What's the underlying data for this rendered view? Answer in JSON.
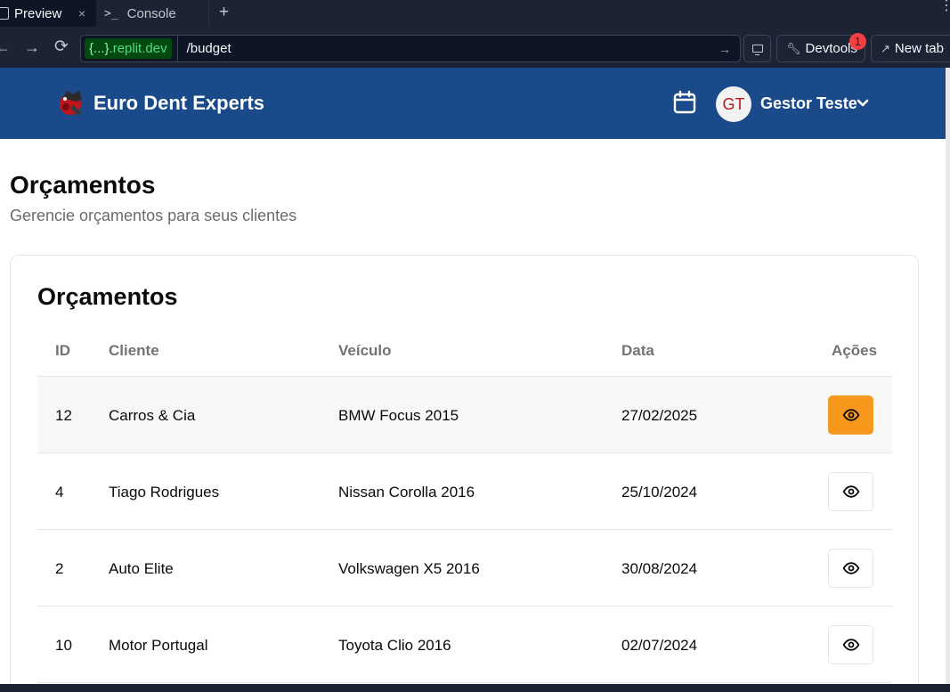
{
  "browser": {
    "tabs": [
      {
        "label": "Preview",
        "close": "×"
      },
      {
        "label": "Console",
        "icon": ">_"
      }
    ],
    "add_tab": "+",
    "more": "⋮",
    "url_domain_braces": "{...}",
    "url_domain": ".replit.dev",
    "url_path": "/budget",
    "devtools_label": "Devtools",
    "devtools_badge": "1",
    "newtab_label": "New tab"
  },
  "app": {
    "brand": "Euro Dent Experts",
    "user_initials": "GT",
    "user_name": "Gestor Teste",
    "colors": {
      "header": "#1a4a8a",
      "accent": "#f7981c"
    }
  },
  "page": {
    "title": "Orçamentos",
    "subtitle": "Gerencie orçamentos para seus clientes"
  },
  "card": {
    "title": "Orçamentos",
    "columns": {
      "id": "ID",
      "cliente": "Cliente",
      "veiculo": "Veículo",
      "data": "Data",
      "acoes": "Ações"
    },
    "rows": [
      {
        "id": "12",
        "cliente": "Carros & Cia",
        "veiculo": "BMW Focus 2015",
        "data": "27/02/2025"
      },
      {
        "id": "4",
        "cliente": "Tiago Rodrigues",
        "veiculo": "Nissan Corolla 2016",
        "data": "25/10/2024"
      },
      {
        "id": "2",
        "cliente": "Auto Elite",
        "veiculo": "Volkswagen X5 2016",
        "data": "30/08/2024"
      },
      {
        "id": "10",
        "cliente": "Motor Portugal",
        "veiculo": "Toyota Clio 2016",
        "data": "02/07/2024"
      }
    ]
  }
}
